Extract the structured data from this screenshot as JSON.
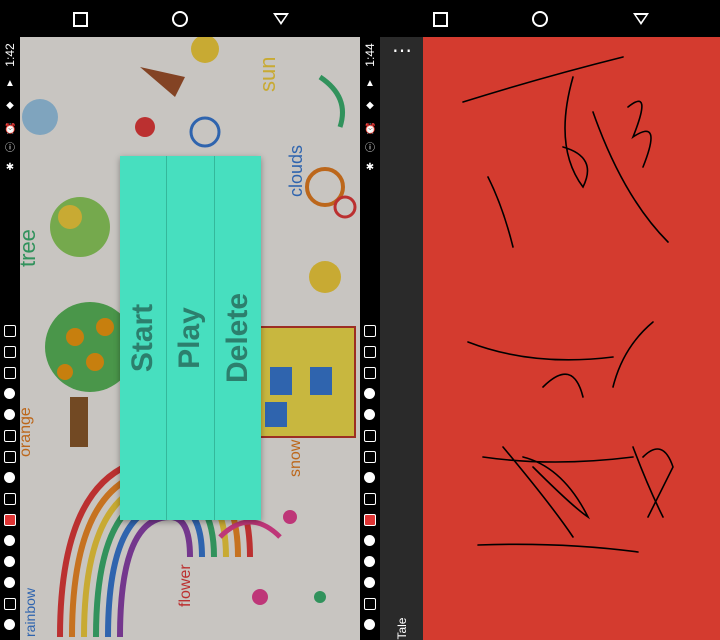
{
  "left": {
    "status_time": "1:42",
    "menu": {
      "items": [
        {
          "label": "Start"
        },
        {
          "label": "Play"
        },
        {
          "label": "Delete"
        }
      ]
    }
  },
  "right": {
    "status_time": "1:44",
    "app_title": "Kids Tale",
    "canvas_bg": "#d43b2f",
    "sidebar_bg": "#2a2a2a"
  },
  "menu_color": "#47dfbf",
  "menu_text_color": "#2c7f6d"
}
